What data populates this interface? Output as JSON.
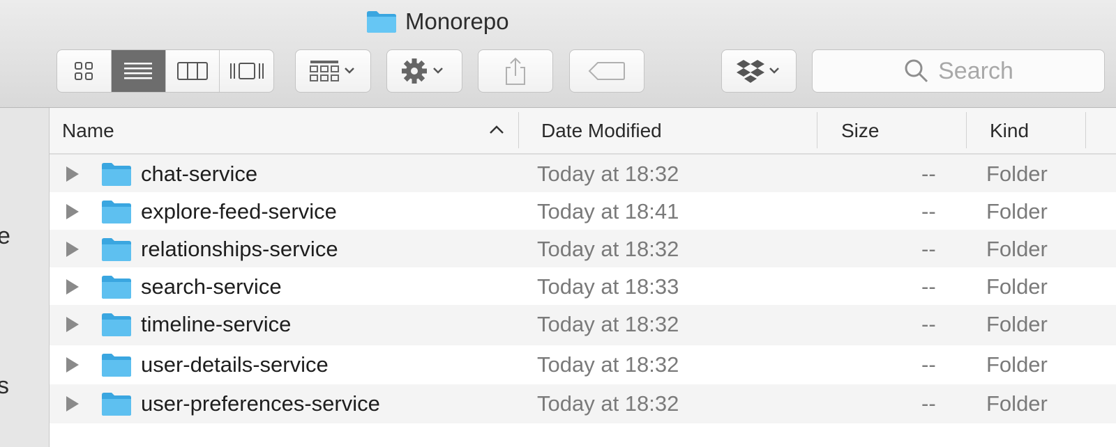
{
  "window": {
    "title": "Monorepo"
  },
  "toolbar": {
    "view_modes": [
      "icon-view",
      "list-view",
      "column-view",
      "cover-flow-view"
    ],
    "active_view": "list-view",
    "search_placeholder": "Search"
  },
  "sidebar": {
    "fragments": [
      "e",
      "s"
    ]
  },
  "columns": {
    "name": "Name",
    "date": "Date Modified",
    "size": "Size",
    "kind": "Kind"
  },
  "rows": [
    {
      "name": "chat-service",
      "date": "Today at 18:32",
      "size": "--",
      "kind": "Folder"
    },
    {
      "name": "explore-feed-service",
      "date": "Today at 18:41",
      "size": "--",
      "kind": "Folder"
    },
    {
      "name": "relationships-service",
      "date": "Today at 18:32",
      "size": "--",
      "kind": "Folder"
    },
    {
      "name": "search-service",
      "date": "Today at 18:33",
      "size": "--",
      "kind": "Folder"
    },
    {
      "name": "timeline-service",
      "date": "Today at 18:32",
      "size": "--",
      "kind": "Folder"
    },
    {
      "name": "user-details-service",
      "date": "Today at 18:32",
      "size": "--",
      "kind": "Folder"
    },
    {
      "name": "user-preferences-service",
      "date": "Today at 18:32",
      "size": "--",
      "kind": "Folder"
    }
  ],
  "colors": {
    "folder": "#5ec0f0",
    "folder_dark": "#3aa6e0",
    "active_segment": "#6d6d6d"
  }
}
